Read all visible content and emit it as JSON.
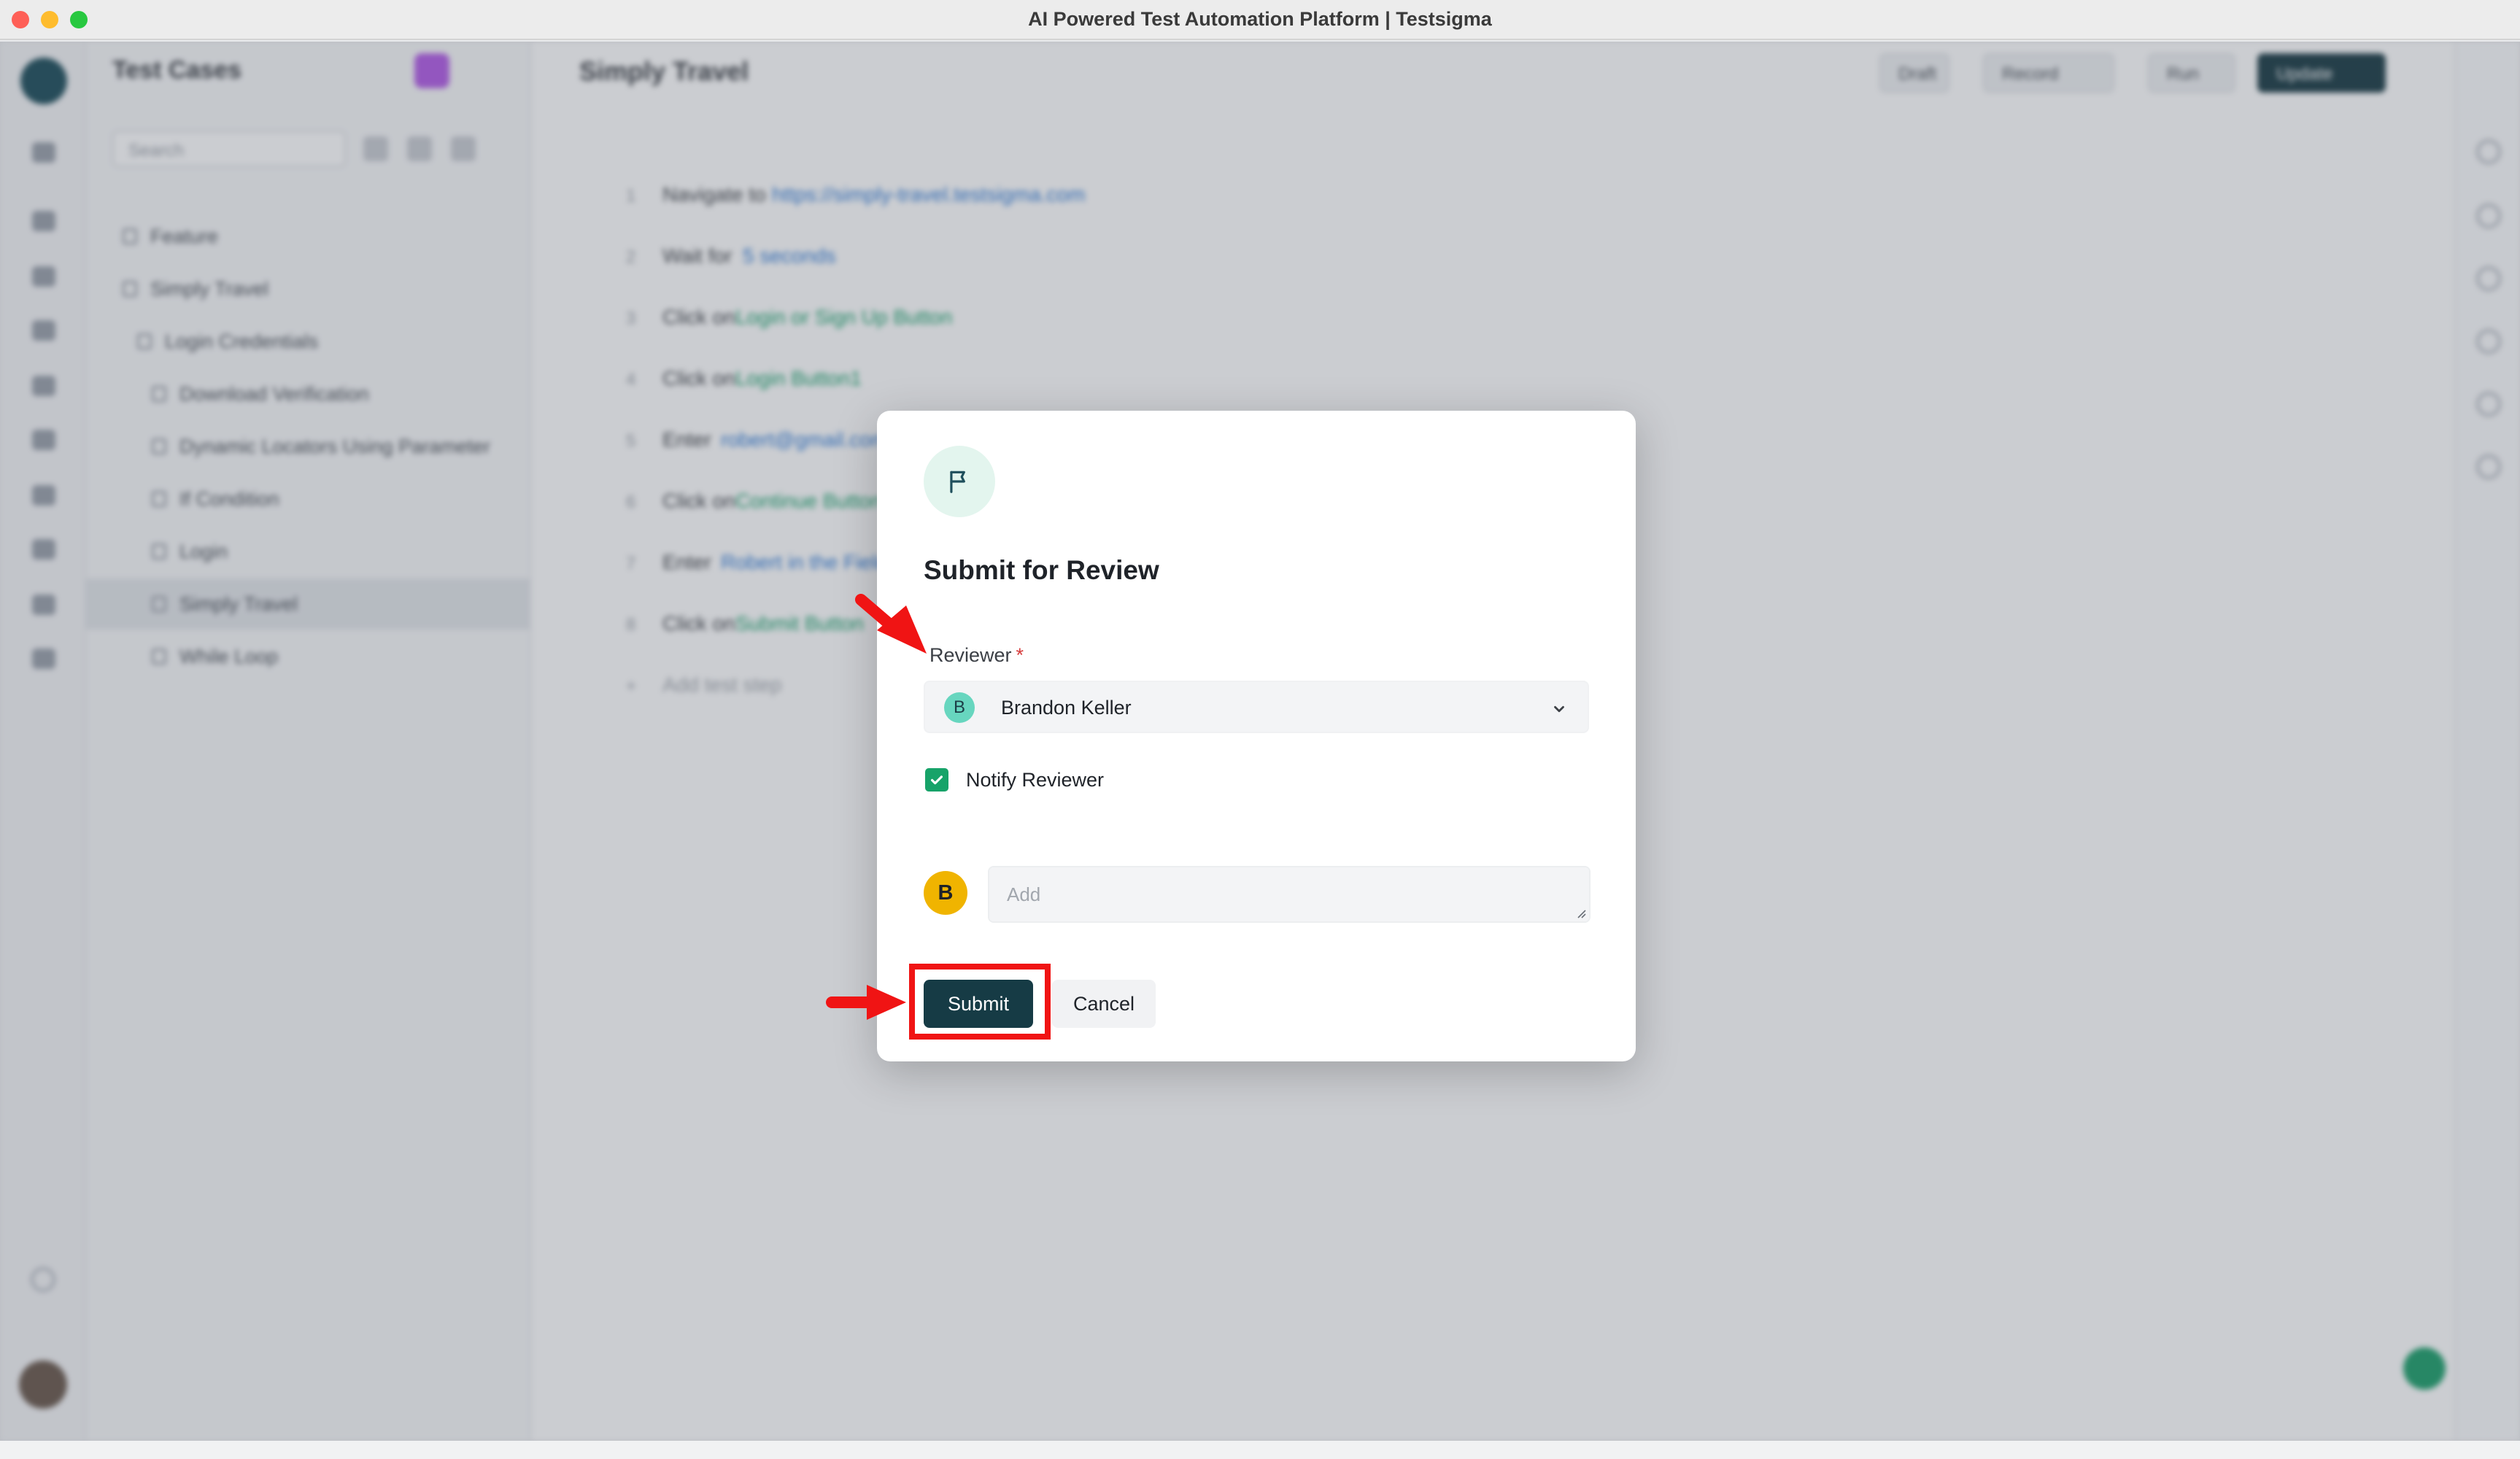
{
  "window": {
    "title": "AI Powered Test Automation Platform | Testsigma"
  },
  "background": {
    "sidebar": {
      "title": "Test Cases",
      "search_placeholder": "Search",
      "tree": [
        {
          "label": "Feature"
        },
        {
          "label": "Simply Travel"
        },
        {
          "label": "Login Credentials"
        },
        {
          "label": "Download Verification"
        },
        {
          "label": "Dynamic Locators Using Parameter"
        },
        {
          "label": "If Condition"
        },
        {
          "label": "Login"
        },
        {
          "label": "Simply Travel"
        },
        {
          "label": "While Loop"
        }
      ]
    },
    "main": {
      "title": "Simply Travel",
      "header_buttons": {
        "draft": "Draft",
        "record": "Record",
        "run": "Run",
        "update": "Update"
      },
      "steps": [
        {
          "num": "1",
          "action": "Navigate to",
          "value": "https://simply-travel.testsigma.com"
        },
        {
          "num": "2",
          "action": "Wait for",
          "value": "5 seconds"
        },
        {
          "num": "3",
          "action": "Click on",
          "value": "Login or Sign Up Button"
        },
        {
          "num": "4",
          "action": "Click on",
          "value": "Login Button1"
        },
        {
          "num": "5",
          "action": "Enter",
          "value": "robert@gmail.com"
        },
        {
          "num": "6",
          "action": "Click on",
          "value": "Continue Button"
        },
        {
          "num": "7",
          "action": "Enter",
          "value": "Robert in the Field"
        },
        {
          "num": "8",
          "action": "Click on",
          "value": "Submit Button"
        },
        {
          "num": "+",
          "action": "Add test step",
          "value": ""
        }
      ]
    }
  },
  "modal": {
    "title": "Submit for Review",
    "reviewer_label": "Reviewer",
    "required_mark": "*",
    "reviewer": {
      "initial": "B",
      "name": "Brandon Keller"
    },
    "notify": {
      "label": "Notify Reviewer",
      "checked": true
    },
    "comment": {
      "avatar_initial": "B",
      "placeholder": "Add",
      "value": ""
    },
    "buttons": {
      "submit": "Submit",
      "cancel": "Cancel"
    }
  },
  "colors": {
    "primary": "#163b45",
    "success": "#17a369",
    "annotation_red": "#f01414",
    "reviewer_avatar": "#67d6bf",
    "user_avatar": "#f0b400"
  },
  "icons": [
    "flag-icon",
    "chevron-down-icon",
    "check-icon",
    "resize-grip-icon",
    "arrow-annotation"
  ]
}
